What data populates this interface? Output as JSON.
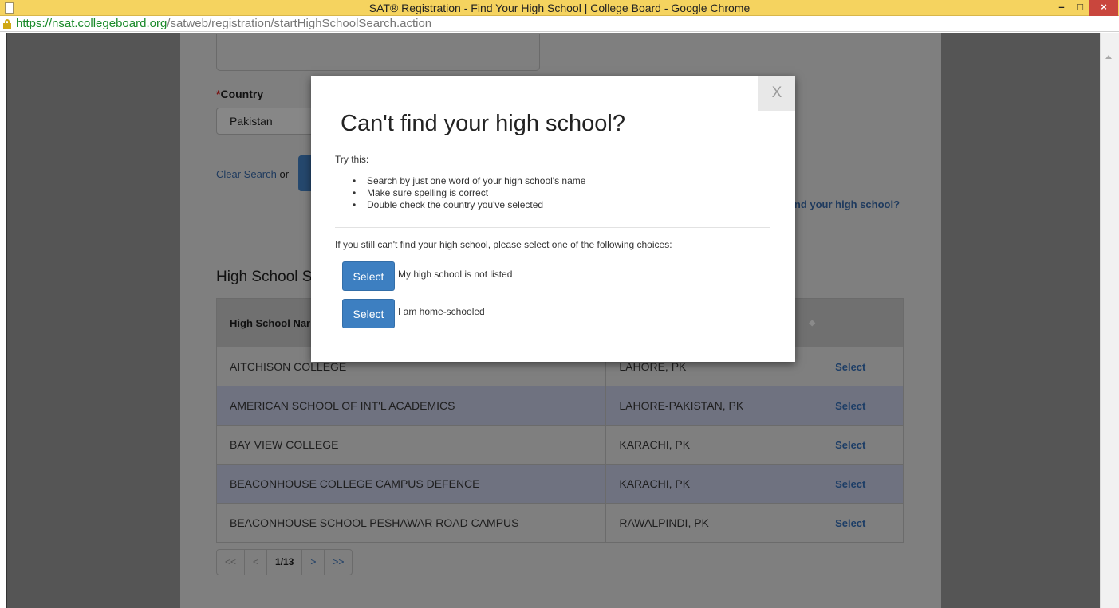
{
  "window": {
    "title": "SAT® Registration - Find Your High School | College Board - Google Chrome",
    "minimize": "–",
    "maximize": "□",
    "close": "×"
  },
  "address_bar": {
    "host": "https://nsat.collegeboard.org",
    "path": "/satweb/registration/startHighSchoolSearch.action"
  },
  "form": {
    "country_required_mark": "*",
    "country_label": "Country",
    "country_value": "Pakistan",
    "clear_search": "Clear Search",
    "or": " or",
    "cant_find_link": "t find your high school?"
  },
  "results": {
    "title": "High School Se",
    "columns": [
      "High School Nar",
      "",
      ""
    ],
    "rows": [
      {
        "name": "AITCHISON COLLEGE",
        "location": "LAHORE, PK",
        "action": "Select"
      },
      {
        "name": "AMERICAN SCHOOL OF INT'L ACADEMICS",
        "location": "LAHORE-PAKISTAN, PK",
        "action": "Select"
      },
      {
        "name": "BAY VIEW COLLEGE",
        "location": "KARACHI, PK",
        "action": "Select"
      },
      {
        "name": "BEACONHOUSE COLLEGE CAMPUS DEFENCE",
        "location": "KARACHI, PK",
        "action": "Select"
      },
      {
        "name": "BEACONHOUSE SCHOOL PESHAWAR ROAD CAMPUS",
        "location": "RAWALPINDI, PK",
        "action": "Select"
      }
    ],
    "pager": {
      "first": "<<",
      "prev": "<",
      "current": "1/13",
      "next": ">",
      "last": ">>"
    }
  },
  "modal": {
    "close": "X",
    "title": "Can't find your high school?",
    "try_this": "Try this:",
    "tips": [
      "Search by just one word of your high school's name",
      "Make sure spelling is correct",
      "Double check the country you've selected"
    ],
    "instruction": "If you still can't find your high school, please select one of the following choices:",
    "choices": [
      {
        "button": "Select",
        "label": "My high school is not listed"
      },
      {
        "button": "Select",
        "label": "I am home-schooled"
      }
    ]
  }
}
